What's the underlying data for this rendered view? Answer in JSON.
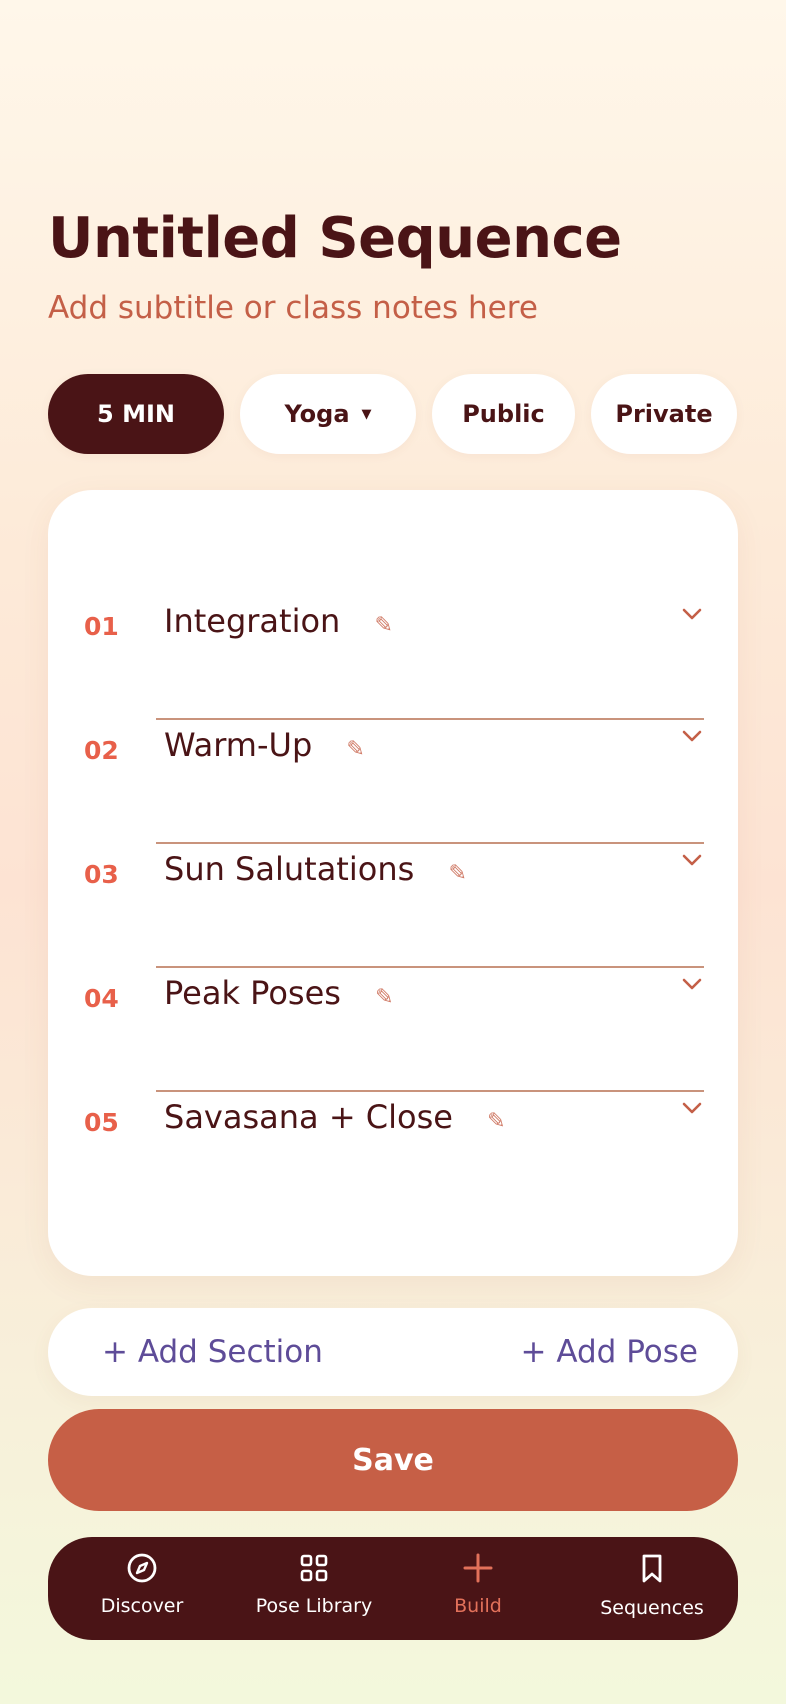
{
  "sequence": {
    "title": "Untitled Sequence",
    "subtitle_placeholder": "Add subtitle or class notes here"
  },
  "chips": {
    "duration": "5 MIN",
    "style": "Yoga",
    "visibility_public": "Public",
    "visibility_private": "Private"
  },
  "sections": [
    {
      "number": "01",
      "name": "Integration"
    },
    {
      "number": "02",
      "name": "Warm-Up"
    },
    {
      "number": "03",
      "name": "Sun Salutations"
    },
    {
      "number": "04",
      "name": "Peak Poses"
    },
    {
      "number": "05",
      "name": "Savasana + Close"
    }
  ],
  "actions": {
    "add_section": "+ Add Section",
    "add_pose": "+ Add Pose"
  },
  "save_label": "Save",
  "nav": [
    {
      "label": "Discover",
      "icon": "compass-icon"
    },
    {
      "label": "Pose Library",
      "icon": "grid-icon"
    },
    {
      "label": "Build",
      "icon": "plus-icon",
      "active": true
    },
    {
      "label": "Sequences",
      "icon": "bookmark-icon"
    }
  ],
  "colors": {
    "primary_dark": "#4a1416",
    "accent": "#c65f46",
    "number_accent": "#e8604a",
    "link": "#5e4c98"
  }
}
